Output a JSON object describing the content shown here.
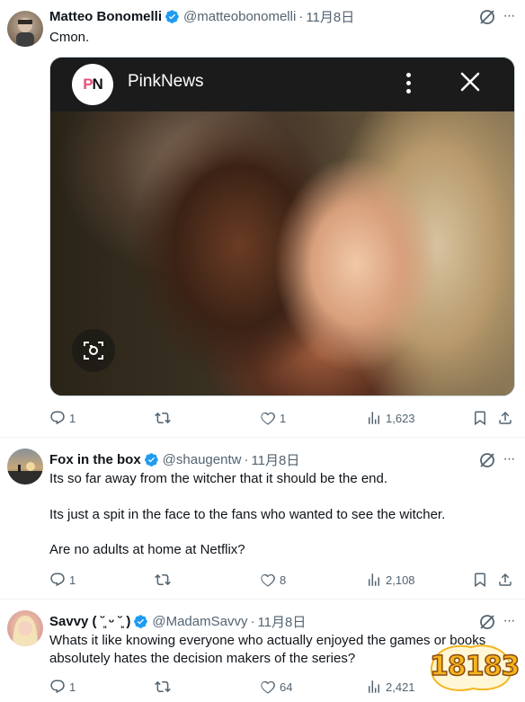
{
  "tweets": [
    {
      "name": "Matteo Bonomelli",
      "handle": "@matteobonomelli",
      "dot": "·",
      "date": "11月8日",
      "text": "Cmon.",
      "media": {
        "source_name": "PinkNews",
        "logo_text_p": "P",
        "logo_text_n": "N"
      },
      "replies": "1",
      "retweets": "",
      "likes": "1",
      "views": "1,623"
    },
    {
      "name": "Fox in the box",
      "handle": "@shaugentw",
      "dot": "·",
      "date": "11月8日",
      "text_lines": [
        "Its so far away from the witcher that it should be the end.",
        "Its just a spit in the face to the fans who wanted to see the witcher.",
        "Are no adults at home at Netflix?"
      ],
      "replies": "1",
      "retweets": "",
      "likes": "8",
      "views": "2,108"
    },
    {
      "name": "Savvy ( ˘͈ ᵕ ˘͈ )",
      "handle": "@MadamSavvy",
      "dot": "·",
      "date": "11月8日",
      "text": "Whats it like knowing everyone who actually enjoyed the games or books absolutely hates the decision makers of the series?",
      "replies": "1",
      "retweets": "",
      "likes": "64",
      "views": "2,421"
    }
  ],
  "watermark": {
    "text": "18183"
  },
  "colors": {
    "text": "#0f1419",
    "muted": "#536471",
    "verified": "#1d9bf0",
    "divider": "#eff3f4",
    "pink": "#e8527a"
  },
  "icons": {
    "reply": "reply-icon",
    "retweet": "retweet-icon",
    "like": "heart-icon",
    "views": "views-icon",
    "bookmark": "bookmark-icon",
    "share": "share-icon",
    "grok": "grok-icon",
    "more": "more-icon",
    "verified": "verified-badge-icon",
    "lens": "lens-icon",
    "close": "close-icon"
  }
}
